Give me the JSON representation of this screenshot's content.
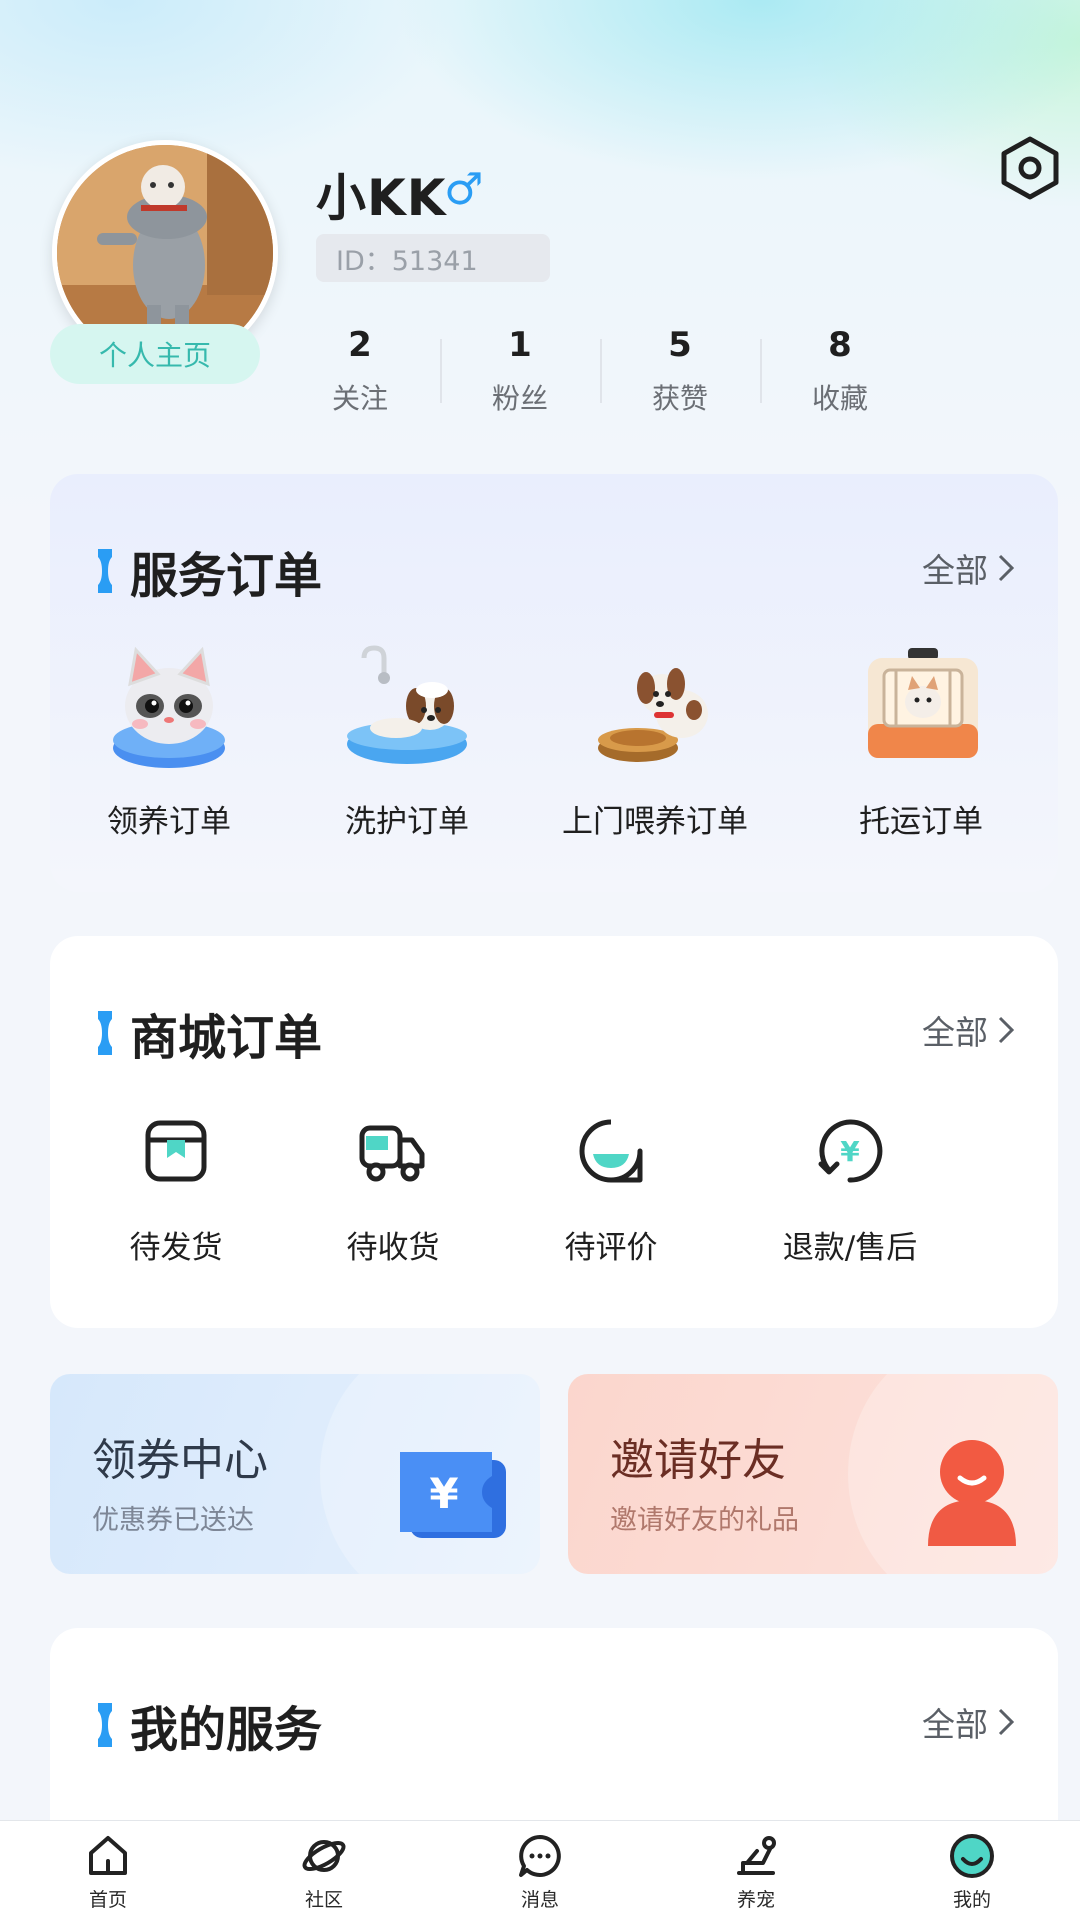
{
  "profile": {
    "username": "小KK",
    "gender_symbol": "♂",
    "id_text": "ID：51341",
    "homepage_label": "个人主页"
  },
  "stats": [
    {
      "value": "2",
      "label": "关注"
    },
    {
      "value": "1",
      "label": "粉丝"
    },
    {
      "value": "5",
      "label": "获赞"
    },
    {
      "value": "8",
      "label": "收藏"
    }
  ],
  "service_orders": {
    "title": "服务订单",
    "all_label": "全部",
    "items": [
      {
        "label": "领养订单",
        "icon": "cat-in-bowl-icon"
      },
      {
        "label": "洗护订单",
        "icon": "dog-bath-icon"
      },
      {
        "label": "上门喂养订单",
        "icon": "dog-feeding-icon"
      },
      {
        "label": "托运订单",
        "icon": "pet-carrier-icon"
      }
    ]
  },
  "mall_orders": {
    "title": "商城订单",
    "all_label": "全部",
    "items": [
      {
        "label": "待发货",
        "icon": "package-icon"
      },
      {
        "label": "待收货",
        "icon": "truck-icon"
      },
      {
        "label": "待评价",
        "icon": "review-icon"
      },
      {
        "label": "退款/售后",
        "icon": "refund-icon"
      }
    ]
  },
  "promos": {
    "coupon": {
      "title": "领券中心",
      "subtitle": "优惠券已送达",
      "icon": "coupon-yen-icon"
    },
    "invite": {
      "title": "邀请好友",
      "subtitle": "邀请好友的礼品",
      "icon": "person-icon"
    }
  },
  "my_services": {
    "title": "我的服务",
    "all_label": "全部"
  },
  "tabbar": [
    {
      "label": "首页",
      "icon": "home-icon"
    },
    {
      "label": "社区",
      "icon": "planet-icon"
    },
    {
      "label": "消息",
      "icon": "chat-bubble-icon"
    },
    {
      "label": "养宠",
      "icon": "pet-care-icon"
    },
    {
      "label": "我的",
      "icon": "smiley-icon",
      "active": true
    }
  ],
  "colors": {
    "accent": "#2a9df4",
    "teal": "#36b9ad",
    "active_tab": "#4fd6c6"
  }
}
